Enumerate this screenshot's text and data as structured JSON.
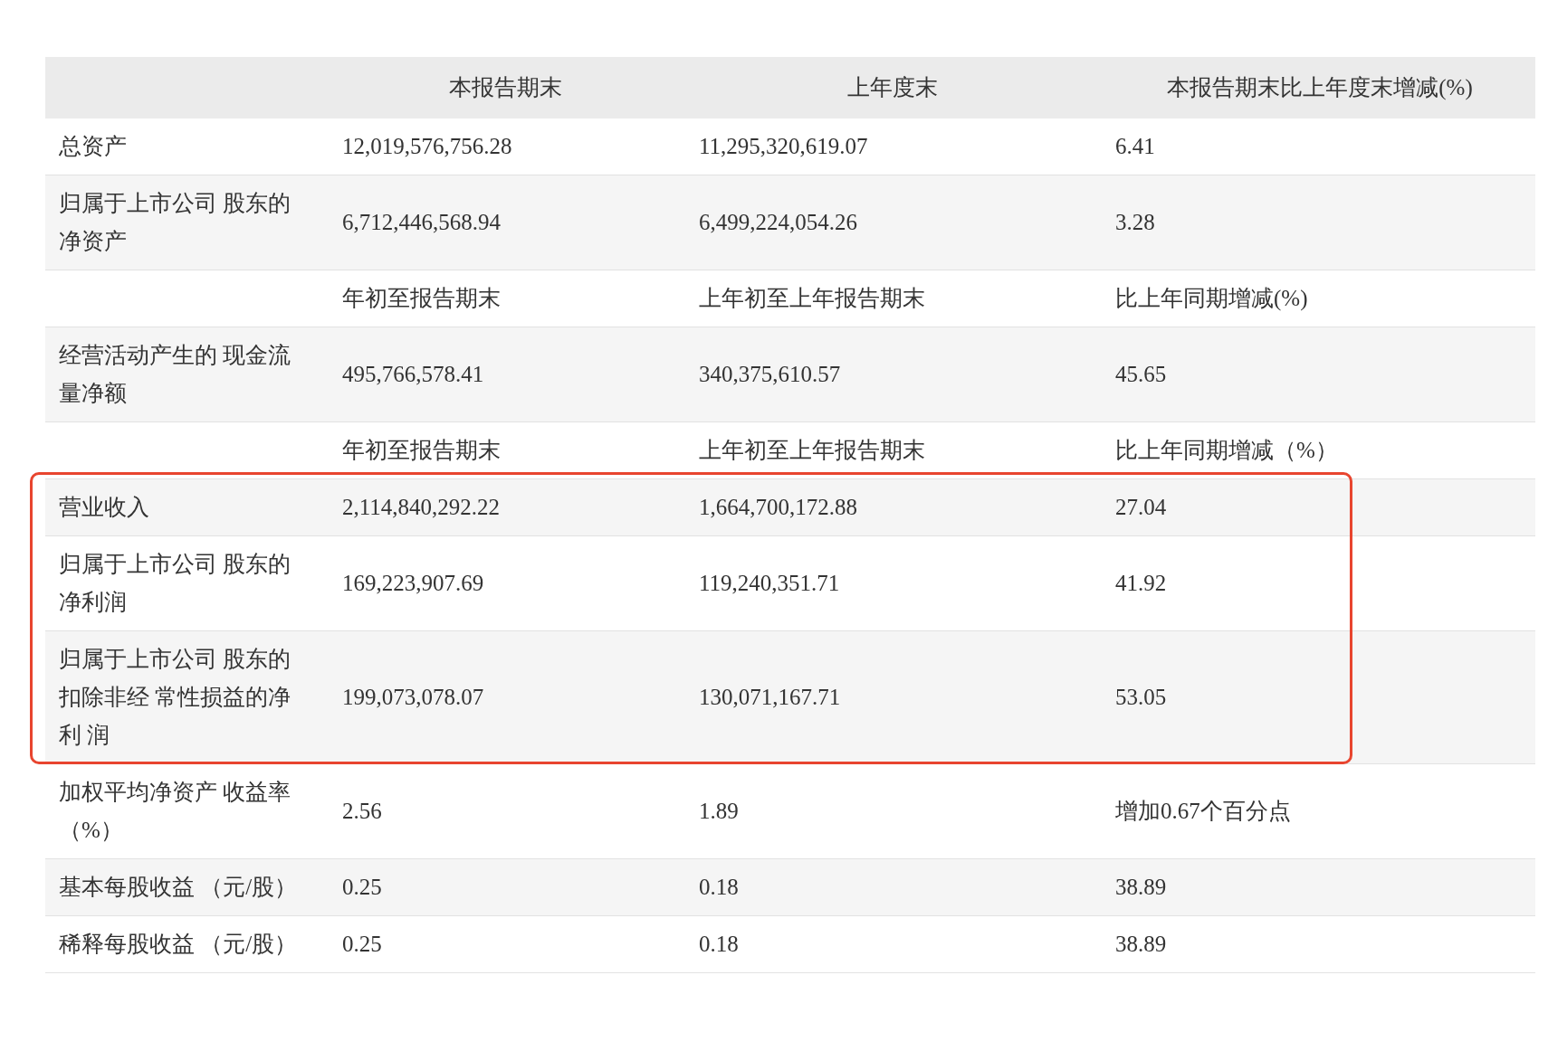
{
  "table": {
    "columns": [
      "本报告期末",
      "上年度末",
      "本报告期末比上年度末增减(%)"
    ],
    "rows": [
      {
        "kind": "data",
        "label": "总资产",
        "cells": [
          "12,019,576,756.28",
          "11,295,320,619.07",
          "6.41"
        ],
        "shaded": false,
        "highlighted": false
      },
      {
        "kind": "data",
        "label": "归属于上市公司 股东的净资产",
        "cells": [
          "6,712,446,568.94",
          "6,499,224,054.26",
          "3.28"
        ],
        "shaded": true,
        "highlighted": false
      },
      {
        "kind": "subheader",
        "cells": [
          "年初至报告期末",
          "上年初至上年报告期末",
          "比上年同期增减(%)"
        ],
        "shaded": false,
        "highlighted": false
      },
      {
        "kind": "data",
        "label": "经营活动产生的 现金流量净额",
        "cells": [
          "495,766,578.41",
          "340,375,610.57",
          "45.65"
        ],
        "shaded": true,
        "highlighted": false
      },
      {
        "kind": "subheader",
        "cells": [
          "年初至报告期末",
          "上年初至上年报告期末",
          "比上年同期增减（%）"
        ],
        "shaded": false,
        "highlighted": false
      },
      {
        "kind": "data",
        "label": "营业收入",
        "cells": [
          "2,114,840,292.22",
          "1,664,700,172.88",
          "27.04"
        ],
        "shaded": true,
        "highlighted": true
      },
      {
        "kind": "data",
        "label": "归属于上市公司 股东的净利润",
        "cells": [
          "169,223,907.69",
          "119,240,351.71",
          "41.92"
        ],
        "shaded": false,
        "highlighted": true
      },
      {
        "kind": "data",
        "label": "归属于上市公司 股东的扣除非经 常性损益的净利 润",
        "cells": [
          "199,073,078.07",
          "130,071,167.71",
          "53.05"
        ],
        "shaded": true,
        "highlighted": true
      },
      {
        "kind": "data",
        "label": "加权平均净资产 收益率（%）",
        "cells": [
          "2.56",
          "1.89",
          "增加0.67个百分点"
        ],
        "shaded": false,
        "highlighted": false
      },
      {
        "kind": "data",
        "label": "基本每股收益 （元/股）",
        "cells": [
          "0.25",
          "0.18",
          "38.89"
        ],
        "shaded": true,
        "highlighted": false
      },
      {
        "kind": "data",
        "label": "稀释每股收益 （元/股）",
        "cells": [
          "0.25",
          "0.18",
          "38.89"
        ],
        "shaded": false,
        "highlighted": false
      }
    ]
  }
}
